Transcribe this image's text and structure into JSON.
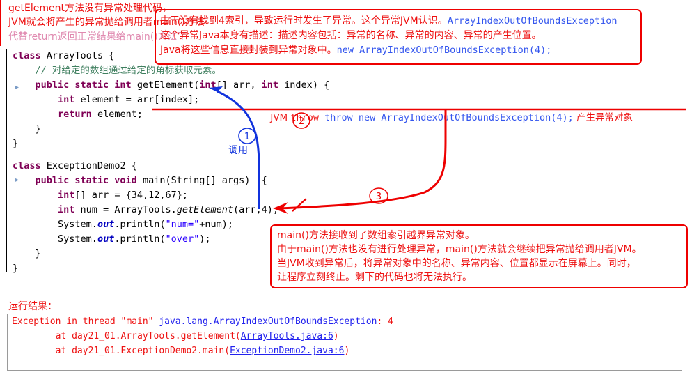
{
  "code_top": {
    "lines": [
      [
        {
          "t": "class ",
          "c": "kw"
        },
        {
          "t": "ArrayTools {",
          "c": "plain"
        }
      ],
      [
        {
          "t": "    ",
          "c": "plain"
        },
        {
          "t": "// 对给定的数组通过给定的角标获取元素。",
          "c": "cmt"
        }
      ],
      [
        {
          "t": "    ",
          "c": "plain"
        },
        {
          "t": "public static int ",
          "c": "kw"
        },
        {
          "t": "getElement(",
          "c": "plain"
        },
        {
          "t": "int",
          "c": "kw"
        },
        {
          "t": "[] arr, ",
          "c": "plain"
        },
        {
          "t": "int",
          "c": "kw"
        },
        {
          "t": " index) {",
          "c": "plain"
        }
      ],
      [
        {
          "t": "        ",
          "c": "plain"
        },
        {
          "t": "int ",
          "c": "kw"
        },
        {
          "t": "element = arr[index];",
          "c": "plain"
        }
      ],
      [
        {
          "t": "        ",
          "c": "plain"
        },
        {
          "t": "return ",
          "c": "kw"
        },
        {
          "t": "element;",
          "c": "plain"
        }
      ],
      [
        {
          "t": "    }",
          "c": "plain"
        }
      ],
      [
        {
          "t": "}",
          "c": "plain"
        }
      ]
    ]
  },
  "code_bottom": {
    "lines": [
      [
        {
          "t": "class ",
          "c": "kw"
        },
        {
          "t": "ExceptionDemo2 {",
          "c": "plain"
        }
      ],
      [
        {
          "t": "    ",
          "c": "plain"
        },
        {
          "t": "public static void ",
          "c": "kw"
        },
        {
          "t": "main(String[] args)  {",
          "c": "plain"
        }
      ],
      [
        {
          "t": "        ",
          "c": "plain"
        },
        {
          "t": "int",
          "c": "kw"
        },
        {
          "t": "[] arr = {34,12,67};",
          "c": "plain"
        }
      ],
      [
        {
          "t": "        ",
          "c": "plain"
        },
        {
          "t": "int ",
          "c": "kw"
        },
        {
          "t": "num = ArrayTools.",
          "c": "plain"
        },
        {
          "t": "getElement",
          "c": "stat"
        },
        {
          "t": "(arr,4);",
          "c": "plain"
        }
      ],
      [
        {
          "t": "        ",
          "c": "plain"
        },
        {
          "t": "System.",
          "c": "plain"
        },
        {
          "t": "out",
          "c": "fld"
        },
        {
          "t": ".println(",
          "c": "plain"
        },
        {
          "t": "\"num=\"",
          "c": "str"
        },
        {
          "t": "+num);",
          "c": "plain"
        }
      ],
      [
        {
          "t": "        ",
          "c": "plain"
        },
        {
          "t": "System.",
          "c": "plain"
        },
        {
          "t": "out",
          "c": "fld"
        },
        {
          "t": ".println(",
          "c": "plain"
        },
        {
          "t": "\"over\"",
          "c": "str"
        },
        {
          "t": ");",
          "c": "plain"
        }
      ],
      [
        {
          "t": "    }",
          "c": "plain"
        }
      ],
      [
        {
          "t": "}",
          "c": "plain"
        }
      ]
    ]
  },
  "annotations": {
    "top_box": {
      "line1_a": "由于没有找到4索引，导致运行时发生了异常。这个异常JVM认识。",
      "line1_b": "ArrayIndexOutOfBoundsException",
      "line2": "这个异常Java本身有描述：描述内容包括：异常的名称、异常的内容、异常的产生位置。",
      "line3_a": "Java将这些信息直接封装到异常对象中。",
      "line3_b": "new ArrayIndexOutOfBoundsException(4);"
    },
    "jvm_throw": {
      "label": "JVM",
      "code": "throw new ArrayIndexOutOfBoundsException(4);",
      "tail": "产生异常对象"
    },
    "right_box": {
      "line1": "getElement方法没有异常处理代码，",
      "line2": "JVM就会将产生的异常抛给调用者main()方法",
      "line3": "代替return返回正常结果给main()方法了"
    },
    "bottom_box": {
      "line1": "main()方法接收到了数组索引越界异常对象。",
      "line2": "由于main()方法也没有进行处理异常，main()方法就会继续把异常抛给调用者JVM。",
      "line3": "当JVM收到异常后，将异常对象中的名称、异常内容、位置都显示在屏幕上。同时，",
      "line4": "让程序立刻终止。剩下的代码也将无法执行。"
    },
    "call_label": "调用",
    "markers": {
      "one": "1",
      "two": "2",
      "three": "3"
    }
  },
  "result": {
    "title": "运行结果：",
    "console": {
      "line1_a": "Exception in thread \"main\" ",
      "line1_link": "java.lang.ArrayIndexOutOfBoundsException",
      "line1_b": ": 4",
      "line2_a": "        at day21_01.ArrayTools.getElement(",
      "line2_link": "ArrayTools.java:6",
      "line2_b": ")",
      "line3_a": "        at day21_01.ExceptionDemo2.main(",
      "line3_link": "ExceptionDemo2.java:6",
      "line3_b": ")"
    }
  },
  "colors": {
    "annotation_red": "#ee1111",
    "code_keyword": "#7f0055",
    "code_string": "#2a00ff",
    "code_comment": "#3f7f5f",
    "link_blue": "#2222ee",
    "blue_arrow": "#1133dd",
    "red_arrow": "#ee0000"
  }
}
